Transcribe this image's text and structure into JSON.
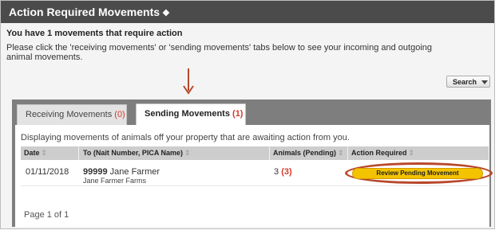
{
  "panel": {
    "title": "Action Required Movements",
    "title_icon": "info-icon",
    "headline": "You have 1 movements that require action",
    "instructions": "Please click the 'receiving movements' or 'sending movements' tabs below to see your incoming and outgoing animal movements.",
    "search_label": "Search"
  },
  "tabs": [
    {
      "label": "Receiving Movements",
      "count": "(0)",
      "active": false
    },
    {
      "label": "Sending Movements",
      "count": "(1)",
      "active": true
    }
  ],
  "table": {
    "caption": "Displaying movements of animals off your property that are awaiting action from you.",
    "headers": [
      "Date",
      "To (Nait Number, PICA Name)",
      "Animals (Pending)",
      "Action Required"
    ],
    "rows": [
      {
        "date": "01/11/2018",
        "nait_number": "99999",
        "recipient_name": "Jane Farmer",
        "farm_name": "Jane Farmer Farms",
        "animals": "3",
        "pending": "(3)",
        "action": "Review Pending Movement"
      }
    ]
  },
  "pager": "Page 1 of 1",
  "colors": {
    "title_bar": "#4b4b4b",
    "tab_area": "#7e7e7e",
    "count_red": "#d33b2c",
    "action_button": "#f4c300",
    "highlight_ring": "#b8482a",
    "arrow": "#b8482a"
  }
}
